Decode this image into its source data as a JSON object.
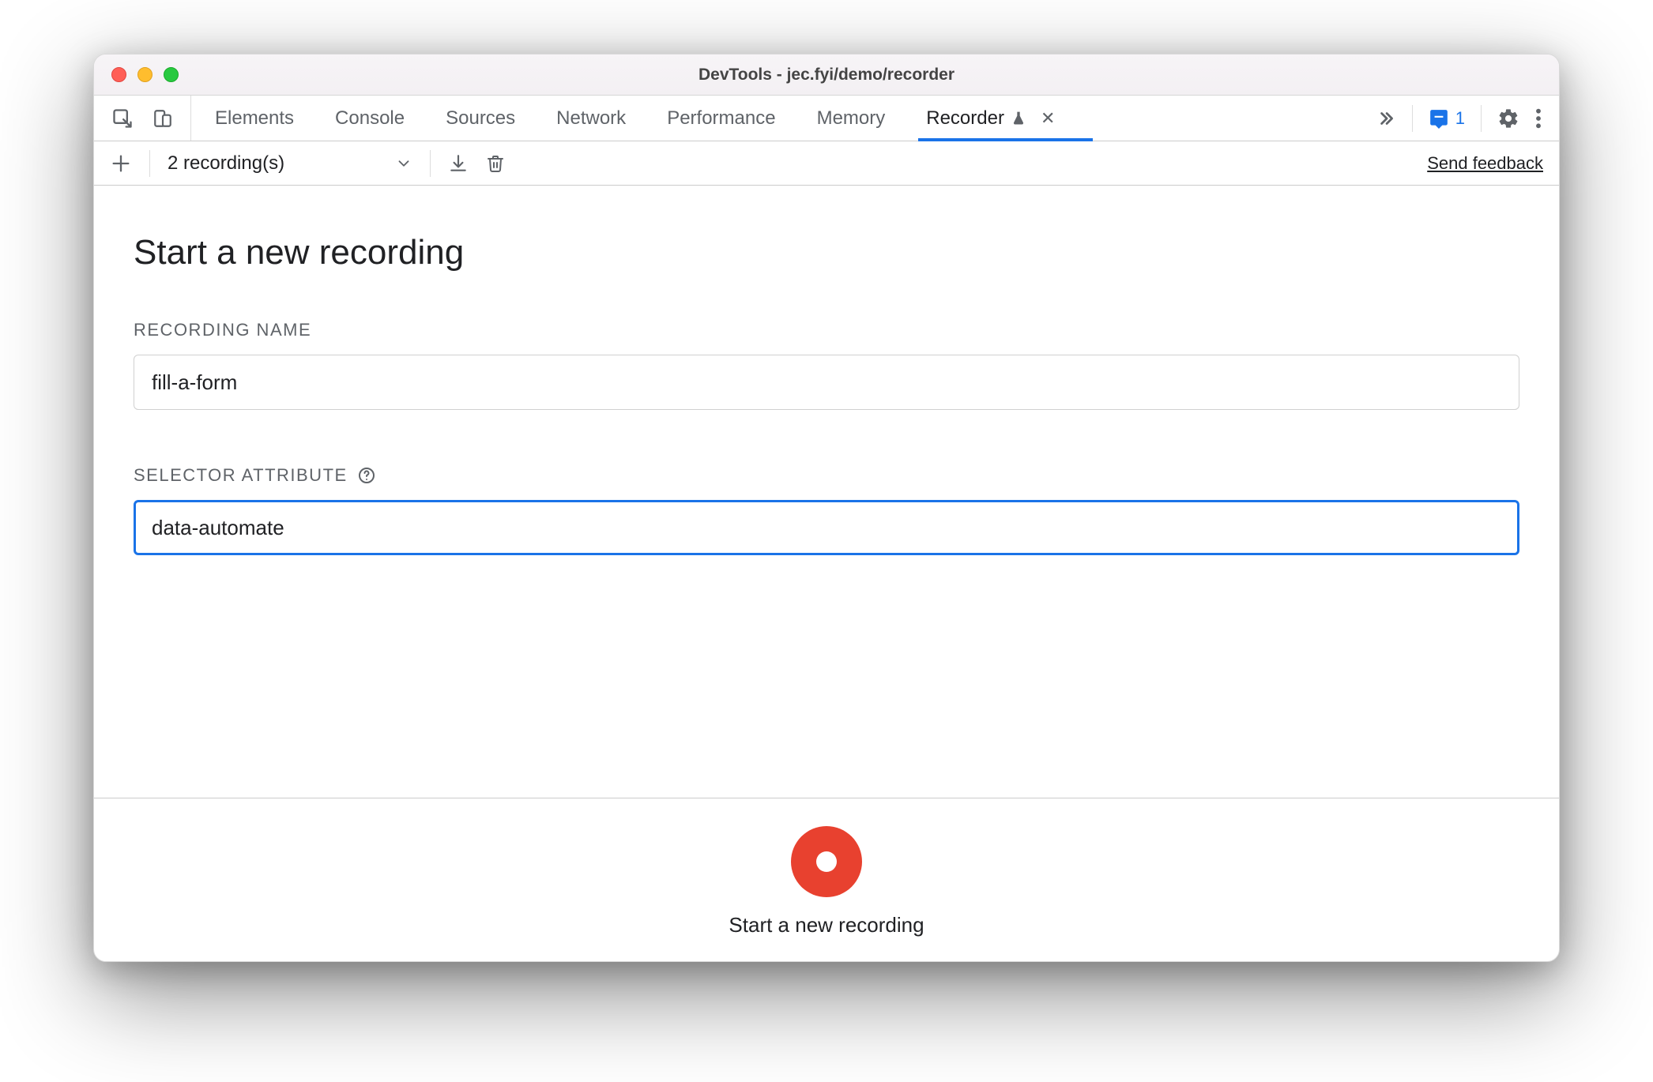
{
  "window": {
    "title": "DevTools - jec.fyi/demo/recorder"
  },
  "tabs": {
    "items": [
      {
        "label": "Elements"
      },
      {
        "label": "Console"
      },
      {
        "label": "Sources"
      },
      {
        "label": "Network"
      },
      {
        "label": "Performance"
      },
      {
        "label": "Memory"
      },
      {
        "label": "Recorder"
      }
    ],
    "active_index": 6,
    "issues_count": "1"
  },
  "toolbar": {
    "recordings_label": "2 recording(s)",
    "feedback_label": "Send feedback"
  },
  "main": {
    "heading": "Start a new recording",
    "recording_name_label": "RECORDING NAME",
    "recording_name_value": "fill-a-form",
    "selector_attr_label": "SELECTOR ATTRIBUTE",
    "selector_attr_value": "data-automate"
  },
  "footer": {
    "record_label": "Start a new recording"
  },
  "colors": {
    "accent": "#1a73e8",
    "record": "#e8412f"
  }
}
